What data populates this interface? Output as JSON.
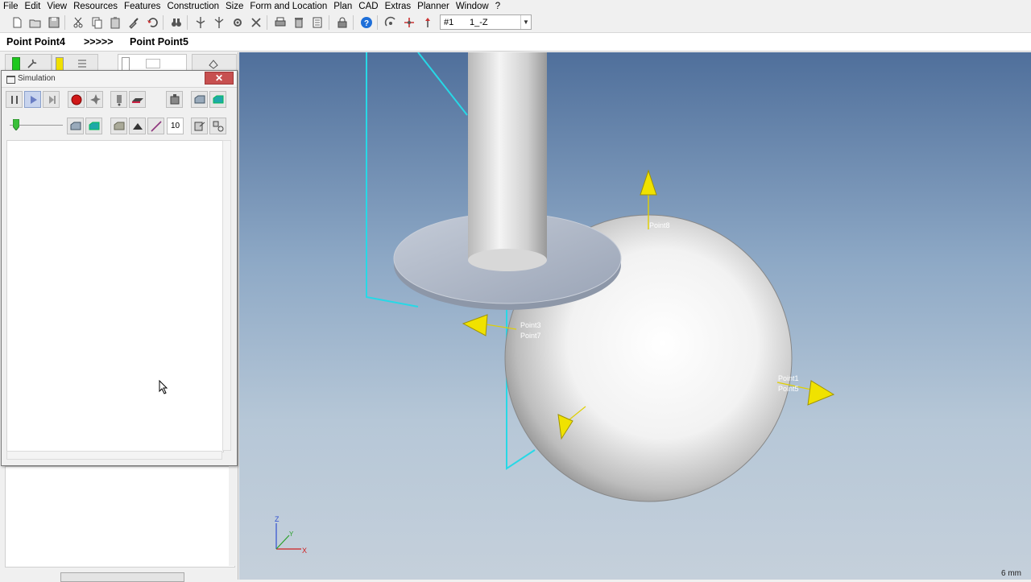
{
  "menu": [
    "File",
    "Edit",
    "View",
    "Resources",
    "Features",
    "Construction",
    "Size",
    "Form and Location",
    "Plan",
    "CAD",
    "Extras",
    "Planner",
    "Window",
    "?"
  ],
  "view_selector": {
    "number": "#1",
    "value": "1_-Z"
  },
  "pointline": {
    "from": "Point  Point4",
    "arrow": ">>>>>",
    "to": "Point  Point5"
  },
  "simulation": {
    "title": "Simulation",
    "speed": "10",
    "close_label": "✕"
  },
  "viewport": {
    "point_labels": {
      "top": "Point8",
      "left_a": "Point3",
      "left_b": "Point7",
      "right_a": "Point1",
      "right_b": "Point5"
    },
    "axis_labels": {
      "z": "Z",
      "y": "Y",
      "x": "X"
    },
    "scale": "6 mm"
  },
  "colors": {
    "accent_blue": "#1e6fd9",
    "record_red": "#d01818",
    "probe_yellow": "#e8e000",
    "outline_cyan": "#27d8e6",
    "close_red": "#c75050"
  }
}
